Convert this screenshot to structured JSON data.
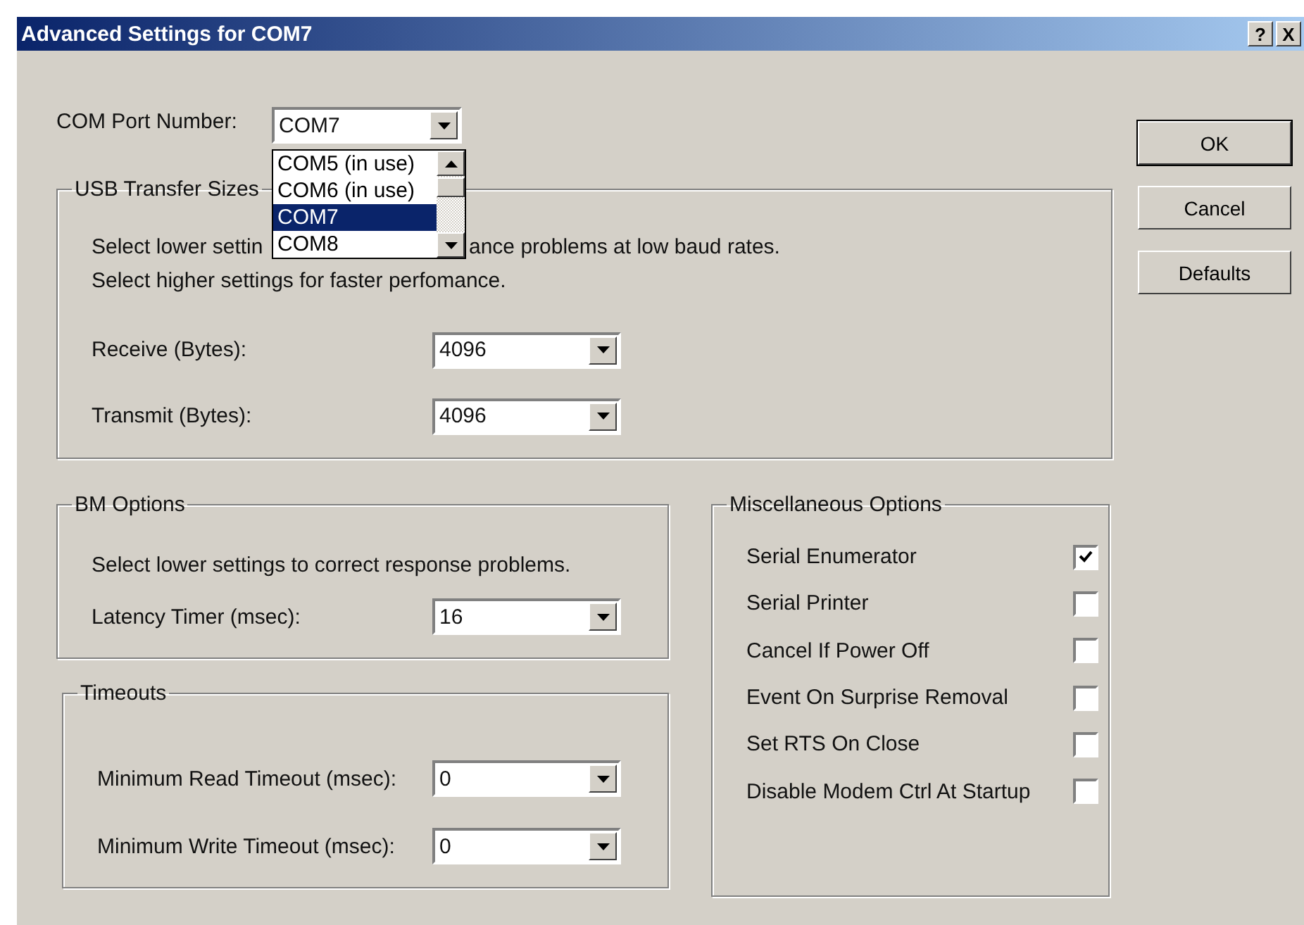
{
  "window": {
    "title": "Advanced Settings for COM7",
    "title_buttons": [
      "?",
      "X"
    ]
  },
  "com_port": {
    "label": "COM Port Number:",
    "value": "COM7",
    "expanded": true,
    "options": [
      {
        "label": "COM5 (in use)",
        "selected": false
      },
      {
        "label": "COM6 (in use)",
        "selected": false
      },
      {
        "label": "COM7",
        "selected": true
      },
      {
        "label": "COM8",
        "selected": false
      }
    ]
  },
  "buttons": [
    "OK",
    "Cancel",
    "Defaults"
  ],
  "usb_transfer": {
    "title": "USB Transfer Sizes",
    "hint_lines": [
      [
        "Select lower settin",
        "ance problems at low baud rates."
      ],
      [
        "Select higher settings for faster perfomance."
      ]
    ],
    "fields": [
      {
        "label": "Receive (Bytes):",
        "value": "4096"
      },
      {
        "label": "Transmit (Bytes):",
        "value": "4096"
      }
    ]
  },
  "bm_options": {
    "title": "BM Options",
    "hint": "Select lower settings to correct response problems.",
    "fields": [
      {
        "label": "Latency Timer (msec):",
        "value": "16"
      }
    ]
  },
  "timeouts": {
    "title": "Timeouts",
    "fields": [
      {
        "label": "Minimum Read Timeout (msec):",
        "value": "0"
      },
      {
        "label": "Minimum Write Timeout (msec):",
        "value": "0"
      }
    ]
  },
  "misc": {
    "title": "Miscellaneous Options",
    "options": [
      {
        "label": "Serial Enumerator",
        "checked": true
      },
      {
        "label": "Serial Printer",
        "checked": false
      },
      {
        "label": "Cancel If Power Off",
        "checked": false
      },
      {
        "label": "Event On Surprise Removal",
        "checked": false
      },
      {
        "label": "Set RTS On Close",
        "checked": false
      },
      {
        "label": "Disable Modem Ctrl At Startup",
        "checked": false
      }
    ]
  }
}
